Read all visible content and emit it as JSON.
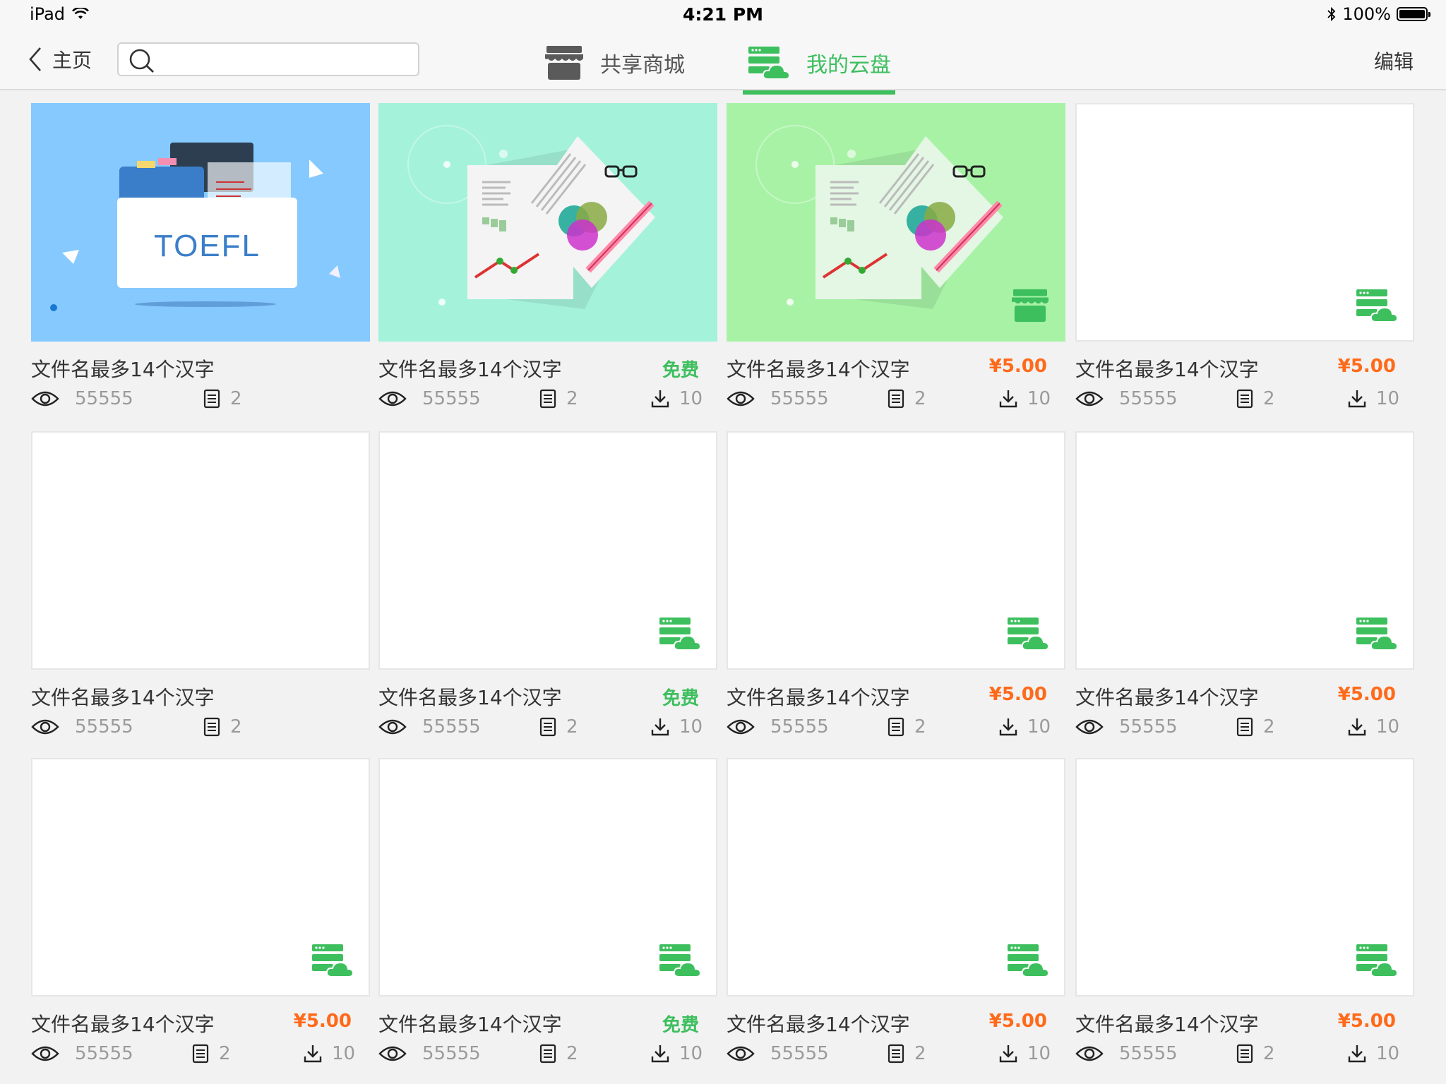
{
  "status_bar": {
    "device": "iPad",
    "time": "4:21 PM",
    "battery": "100%"
  },
  "nav": {
    "back_label": "主页",
    "search_placeholder": "",
    "tabs": [
      {
        "label": "共享商城"
      },
      {
        "label": "我的云盘"
      }
    ],
    "active_tab": "我的云盘",
    "edit_label": "编辑"
  },
  "colors": {
    "accent_green": "#3dbf5e",
    "price_orange": "#ff6a1a"
  },
  "cards": [
    {
      "title": "文件名最多14个汉字",
      "price": "",
      "views": "55555",
      "pages": "2",
      "downloads": "",
      "thumb": "toefl"
    },
    {
      "title": "文件名最多14个汉字",
      "price": "免费",
      "views": "55555",
      "pages": "2",
      "downloads": "10",
      "thumb": "docs-teal"
    },
    {
      "title": "文件名最多14个汉字",
      "price": "¥5.00",
      "views": "55555",
      "pages": "2",
      "downloads": "10",
      "thumb": "docs-green"
    },
    {
      "title": "文件名最多14个汉字",
      "price": "¥5.00",
      "views": "55555",
      "pages": "2",
      "downloads": "10",
      "thumb": "blank"
    },
    {
      "title": "文件名最多14个汉字",
      "price": "",
      "views": "55555",
      "pages": "2",
      "downloads": "",
      "thumb": "blank-none"
    },
    {
      "title": "文件名最多14个汉字",
      "price": "免费",
      "views": "55555",
      "pages": "2",
      "downloads": "10",
      "thumb": "blank"
    },
    {
      "title": "文件名最多14个汉字",
      "price": "¥5.00",
      "views": "55555",
      "pages": "2",
      "downloads": "10",
      "thumb": "blank"
    },
    {
      "title": "文件名最多14个汉字",
      "price": "¥5.00",
      "views": "55555",
      "pages": "2",
      "downloads": "10",
      "thumb": "blank"
    },
    {
      "title": "文件名最多14个汉字",
      "price": "¥5.00",
      "views": "55555",
      "pages": "2",
      "downloads": "10",
      "thumb": "blank"
    },
    {
      "title": "文件名最多14个汉字",
      "price": "免费",
      "views": "55555",
      "pages": "2",
      "downloads": "10",
      "thumb": "blank"
    },
    {
      "title": "文件名最多14个汉字",
      "price": "¥5.00",
      "views": "55555",
      "pages": "2",
      "downloads": "10",
      "thumb": "blank"
    },
    {
      "title": "文件名最多14个汉字",
      "price": "¥5.00",
      "views": "55555",
      "pages": "2",
      "downloads": "10",
      "thumb": "blank"
    }
  ],
  "toefl_label": "TOEFL"
}
